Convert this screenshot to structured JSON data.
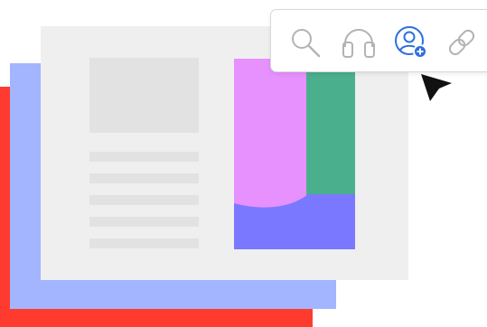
{
  "colors": {
    "back_sheet_red": "#ff3b30",
    "back_sheet_blue": "#a3b5ff",
    "document_bg": "#efefef",
    "placeholder_gray": "#e2e2e2",
    "chart_pink": "#e791ff",
    "chart_green": "#4aaf8d",
    "chart_purple": "#7a78ff",
    "icon_gray": "#b3b3b3",
    "accent_blue": "#2f6fdf",
    "toolbar_bg": "#ffffff",
    "cursor": "#111111"
  },
  "toolbar": {
    "icons": [
      "search-icon",
      "headset-icon",
      "add-user-icon",
      "link-icon"
    ],
    "selected": "add-user-icon"
  },
  "cursor": {
    "icon": "arrow-pointer-icon"
  }
}
